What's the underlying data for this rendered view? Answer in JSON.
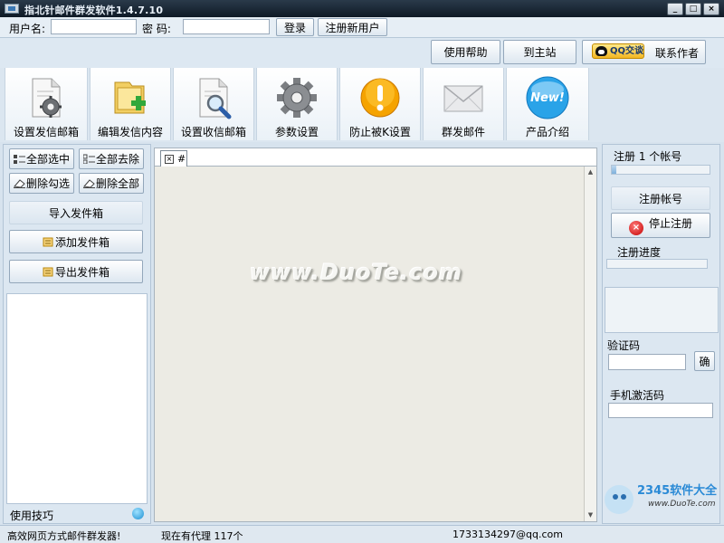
{
  "window": {
    "title": "指北针邮件群发软件1.4.7.10",
    "minimize_label": "_",
    "maximize_label": "□",
    "close_label": "×"
  },
  "login": {
    "username_label": "用户名:",
    "username_value": "",
    "password_label": "密  码:",
    "password_value": "",
    "login_button": "登录",
    "register_button": "注册新用户"
  },
  "help_bar": {
    "help_button": "使用帮助",
    "site_button": "到主站",
    "qq_badge": "QQ交谈",
    "contact_label": "联系作者"
  },
  "toolbar": {
    "items": [
      {
        "label": "设置发信邮箱",
        "icon": "document-gear-icon"
      },
      {
        "label": "编辑发信内容",
        "icon": "folder-add-icon"
      },
      {
        "label": "设置收信邮箱",
        "icon": "document-search-icon"
      },
      {
        "label": "参数设置",
        "icon": "gear-icon"
      },
      {
        "label": "防止被K设置",
        "icon": "warning-icon"
      },
      {
        "label": "群发邮件",
        "icon": "envelope-icon"
      },
      {
        "label": "产品介绍",
        "icon": "new-badge-icon"
      }
    ]
  },
  "left_panel": {
    "select_all": "全部选中",
    "deselect_all": "全部去除",
    "delete_checked": "删除勾选",
    "delete_all": "删除全部",
    "import_outbox": "导入发件箱",
    "add_outbox": "添加发件箱",
    "export_outbox": "导出发件箱",
    "tips_label": "使用技巧"
  },
  "center_panel": {
    "tab_label": "#",
    "tab_close": "×",
    "scroll_up": "▲",
    "scroll_down": "▼",
    "watermark": "www.DuoTe.com"
  },
  "right_panel": {
    "registered_count_label": "注册 1 个帐号",
    "registered_progress": 0.05,
    "register_account_button": "注册帐号",
    "stop_register_button": "停止注册",
    "register_progress_label": "注册进度",
    "register_progress": 0,
    "captcha_label": "验证码",
    "captcha_value": "",
    "confirm_button": "确",
    "phone_activation_label": "手机激活码",
    "phone_activation_value": ""
  },
  "status_bar": {
    "left_text": "高效网页方式邮件群发器!",
    "middle_text": "现在有代理 117个",
    "right_text": "1733134297@qq.com"
  },
  "brand": {
    "logo_text": "2345软件大全",
    "logo_url": "www.DuoTe.com"
  },
  "colors": {
    "title_bar": "#16222f",
    "panel_bg": "#dce7f1",
    "workspace_bg": "#ecebe4",
    "accent_blue": "#1f7fc8",
    "stop_red": "#c40000"
  }
}
